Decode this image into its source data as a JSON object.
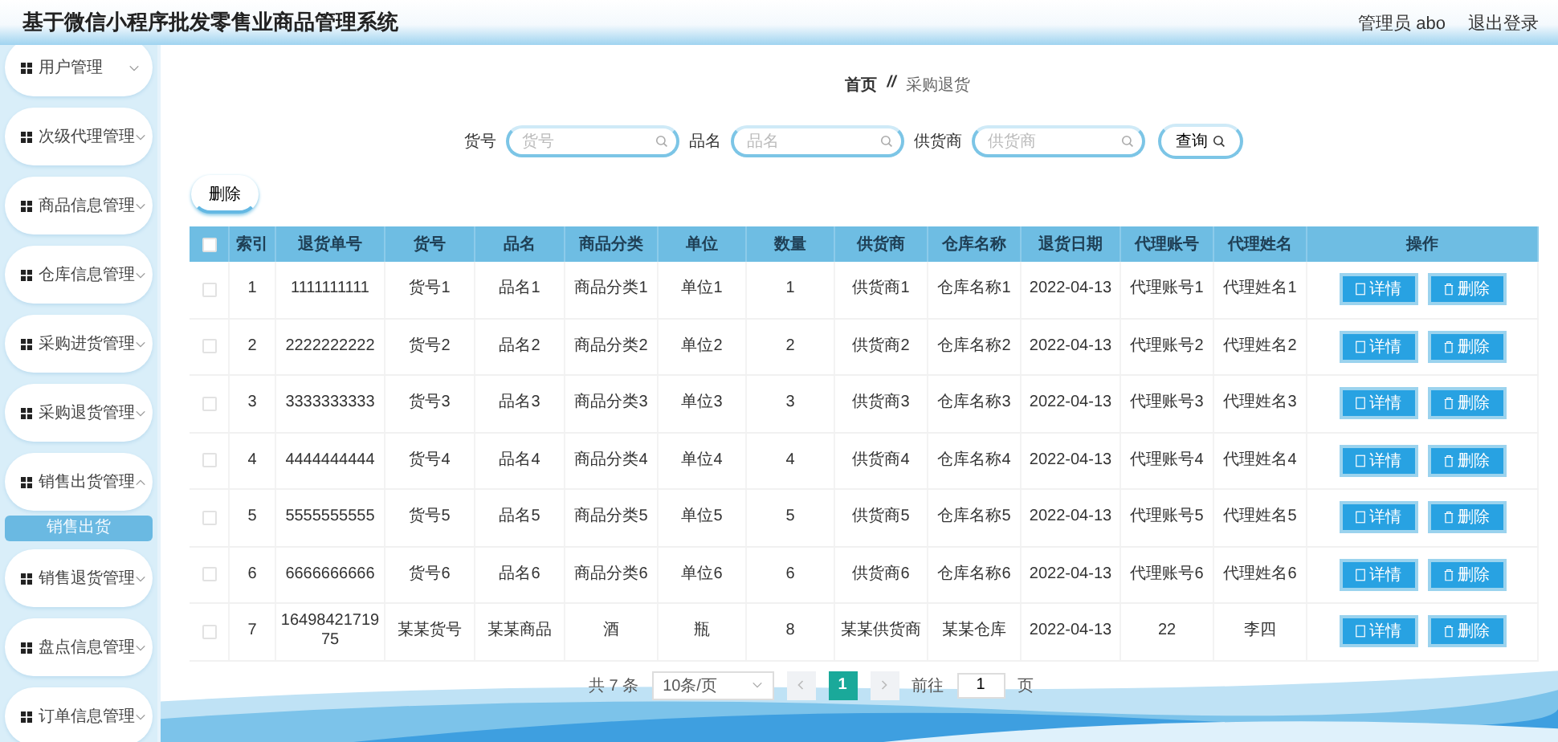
{
  "header": {
    "title": "基于微信小程序批发零售业商品管理系统",
    "user": "管理员 abo",
    "logout": "退出登录"
  },
  "sidebar": {
    "items": [
      {
        "label": "用户管理",
        "expanded": false
      },
      {
        "label": "次级代理管理",
        "expanded": false
      },
      {
        "label": "商品信息管理",
        "expanded": false
      },
      {
        "label": "仓库信息管理",
        "expanded": false
      },
      {
        "label": "采购进货管理",
        "expanded": false
      },
      {
        "label": "采购退货管理",
        "expanded": false
      },
      {
        "label": "销售出货管理",
        "expanded": true,
        "children": [
          {
            "label": "销售出货",
            "selected": true
          }
        ]
      },
      {
        "label": "销售退货管理",
        "expanded": false
      },
      {
        "label": "盘点信息管理",
        "expanded": false
      },
      {
        "label": "订单信息管理",
        "expanded": false
      }
    ]
  },
  "breadcrumb": [
    "首页",
    "//",
    "采购退货"
  ],
  "search": {
    "fields": [
      {
        "label": "货号",
        "placeholder": "货号"
      },
      {
        "label": "品名",
        "placeholder": "品名"
      },
      {
        "label": "供货商",
        "placeholder": "供货商"
      }
    ],
    "button": "查询"
  },
  "delete_button": "删除",
  "table": {
    "header_checked": false,
    "columns": [
      "索引",
      "退货单号",
      "货号",
      "品名",
      "商品分类",
      "单位",
      "数量",
      "供货商",
      "仓库名称",
      "退货日期",
      "代理账号",
      "代理姓名",
      "操作"
    ],
    "rows": [
      {
        "selected": false,
        "cells": [
          "1",
          "1111111111",
          "货号1",
          "品名1",
          "商品分类1",
          "单位1",
          "1",
          "供货商1",
          "仓库名称1",
          "2022-04-13",
          "代理账号1",
          "代理姓名1"
        ],
        "actions": [
          "详情",
          "删除"
        ]
      },
      {
        "selected": false,
        "cells": [
          "2",
          "2222222222",
          "货号2",
          "品名2",
          "商品分类2",
          "单位2",
          "2",
          "供货商2",
          "仓库名称2",
          "2022-04-13",
          "代理账号2",
          "代理姓名2"
        ],
        "actions": [
          "详情",
          "删除"
        ]
      },
      {
        "selected": false,
        "cells": [
          "3",
          "3333333333",
          "货号3",
          "品名3",
          "商品分类3",
          "单位3",
          "3",
          "供货商3",
          "仓库名称3",
          "2022-04-13",
          "代理账号3",
          "代理姓名3"
        ],
        "actions": [
          "详情",
          "删除"
        ]
      },
      {
        "selected": false,
        "cells": [
          "4",
          "4444444444",
          "货号4",
          "品名4",
          "商品分类4",
          "单位4",
          "4",
          "供货商4",
          "仓库名称4",
          "2022-04-13",
          "代理账号4",
          "代理姓名4"
        ],
        "actions": [
          "详情",
          "删除"
        ]
      },
      {
        "selected": false,
        "cells": [
          "5",
          "5555555555",
          "货号5",
          "品名5",
          "商品分类5",
          "单位5",
          "5",
          "供货商5",
          "仓库名称5",
          "2022-04-13",
          "代理账号5",
          "代理姓名5"
        ],
        "actions": [
          "详情",
          "删除"
        ]
      },
      {
        "selected": false,
        "cells": [
          "6",
          "6666666666",
          "货号6",
          "品名6",
          "商品分类6",
          "单位6",
          "6",
          "供货商6",
          "仓库名称6",
          "2022-04-13",
          "代理账号6",
          "代理姓名6"
        ],
        "actions": [
          "详情",
          "删除"
        ]
      },
      {
        "selected": false,
        "cells": [
          "7",
          "1649842171975",
          "某某货号",
          "某某商品",
          "酒",
          "瓶",
          "8",
          "某某供货商",
          "某某仓库",
          "2022-04-13",
          "22",
          "李四"
        ],
        "actions": [
          "详情",
          "删除"
        ]
      }
    ]
  },
  "pagination": {
    "total": "共 7 条",
    "page_size": "10条/页",
    "pages": [
      {
        "label": "1",
        "selected": true
      }
    ],
    "goto_label": "前往",
    "goto_value": "1",
    "goto_unit": "页"
  }
}
